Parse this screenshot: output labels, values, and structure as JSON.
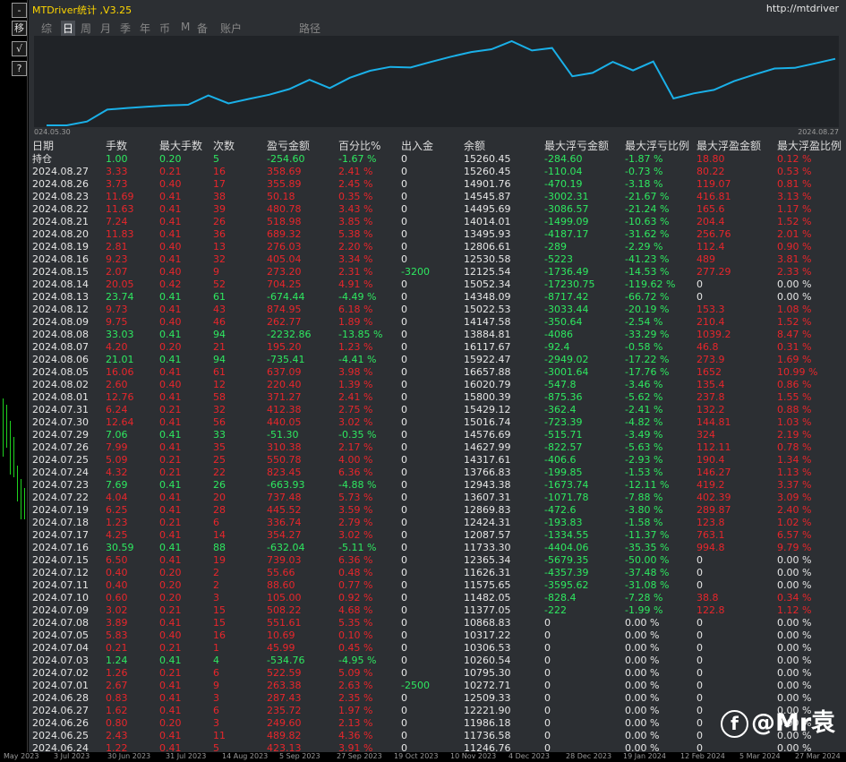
{
  "window": {
    "title": "MTDriver统计 ,V3.25",
    "site": "http://mtdriver"
  },
  "tabs": [
    "综",
    "日",
    "周",
    "月",
    "季",
    "年",
    "币",
    "M",
    "备",
    "账户",
    "",
    "路径"
  ],
  "active_tab": 1,
  "side_buttons": [
    "-",
    "移",
    "√",
    "?"
  ],
  "chart": {
    "type": "line",
    "start_label": "024.05.30",
    "end_label": "2024.08.27",
    "line_color": "#1ab0e8",
    "values": [
      10000,
      10000,
      10306.53,
      11246.76,
      11377.05,
      11482.05,
      11575.65,
      11626.31,
      12365.34,
      11733.3,
      12087.57,
      12424.31,
      12869.83,
      13607.31,
      12943.38,
      13766.83,
      14317.61,
      14627.99,
      14576.69,
      15016.74,
      15429.12,
      15800.39,
      16020.79,
      16657.88,
      15922.47,
      16117.67,
      13884.81,
      14147.58,
      15022.53,
      14348.09,
      15052.34,
      12125.54,
      12530.58,
      12806.61,
      13495.93,
      14014.01,
      14495.69,
      14545.87,
      14901.76,
      15260.45
    ]
  },
  "columns": [
    "日期",
    "手数",
    "最大手数",
    "次数",
    "盈亏金额",
    "百分比%",
    "出入金",
    "余额",
    "最大浮亏金额",
    "最大浮亏比例",
    "最大浮盈金额",
    "最大浮盈比例"
  ],
  "holding": [
    "持仓",
    "1.00",
    "0.20",
    "5",
    "-254.60",
    "-1.67 %",
    "0",
    "15260.45",
    "-284.60",
    "-1.87 %",
    "18.80",
    "0.12 %"
  ],
  "rows": [
    [
      "2024.08.27",
      "3.33",
      "0.21",
      "16",
      "358.69",
      "2.41 %",
      "0",
      "15260.45",
      "-110.04",
      "-0.73 %",
      "80.22",
      "0.53 %"
    ],
    [
      "2024.08.26",
      "3.73",
      "0.40",
      "17",
      "355.89",
      "2.45 %",
      "0",
      "14901.76",
      "-470.19",
      "-3.18 %",
      "119.07",
      "0.81 %"
    ],
    [
      "2024.08.23",
      "11.69",
      "0.41",
      "38",
      "50.18",
      "0.35 %",
      "0",
      "14545.87",
      "-3002.31",
      "-21.67 %",
      "416.81",
      "3.13 %"
    ],
    [
      "2024.08.22",
      "11.63",
      "0.41",
      "39",
      "480.78",
      "3.43 %",
      "0",
      "14495.69",
      "-3086.57",
      "-21.24 %",
      "165.6",
      "1.17 %"
    ],
    [
      "2024.08.21",
      "7.24",
      "0.41",
      "26",
      "518.98",
      "3.85 %",
      "0",
      "14014.01",
      "-1499.09",
      "-10.63 %",
      "204.4",
      "1.52 %"
    ],
    [
      "2024.08.20",
      "11.83",
      "0.41",
      "36",
      "689.32",
      "5.38 %",
      "0",
      "13495.93",
      "-4187.17",
      "-31.62 %",
      "256.76",
      "2.01 %"
    ],
    [
      "2024.08.19",
      "2.81",
      "0.40",
      "13",
      "276.03",
      "2.20 %",
      "0",
      "12806.61",
      "-289",
      "-2.29 %",
      "112.4",
      "0.90 %"
    ],
    [
      "2024.08.16",
      "9.23",
      "0.41",
      "32",
      "405.04",
      "3.34 %",
      "0",
      "12530.58",
      "-5223",
      "-41.23 %",
      "489",
      "3.81 %"
    ],
    [
      "2024.08.15",
      "2.07",
      "0.40",
      "9",
      "273.20",
      "2.31 %",
      "-3200",
      "12125.54",
      "-1736.49",
      "-14.53 %",
      "277.29",
      "2.33 %"
    ],
    [
      "2024.08.14",
      "20.05",
      "0.42",
      "52",
      "704.25",
      "4.91 %",
      "0",
      "15052.34",
      "-17230.75",
      "-119.62 %",
      "0",
      "0.00 %"
    ],
    [
      "2024.08.13",
      "23.74",
      "0.41",
      "61",
      "-674.44",
      "-4.49 %",
      "0",
      "14348.09",
      "-8717.42",
      "-66.72 %",
      "0",
      "0.00 %"
    ],
    [
      "2024.08.12",
      "9.73",
      "0.41",
      "43",
      "874.95",
      "6.18 %",
      "0",
      "15022.53",
      "-3033.44",
      "-20.19 %",
      "153.3",
      "1.08 %"
    ],
    [
      "2024.08.09",
      "9.75",
      "0.40",
      "46",
      "262.77",
      "1.89 %",
      "0",
      "14147.58",
      "-350.64",
      "-2.54 %",
      "210.4",
      "1.52 %"
    ],
    [
      "2024.08.08",
      "33.03",
      "0.41",
      "94",
      "-2232.86",
      "-13.85 %",
      "0",
      "13884.81",
      "-4086",
      "-33.29 %",
      "1039.2",
      "8.47 %"
    ],
    [
      "2024.08.07",
      "4.20",
      "0.20",
      "21",
      "195.20",
      "1.23 %",
      "0",
      "16117.67",
      "-92.4",
      "-0.58 %",
      "46.8",
      "0.31 %"
    ],
    [
      "2024.08.06",
      "21.01",
      "0.41",
      "94",
      "-735.41",
      "-4.41 %",
      "0",
      "15922.47",
      "-2949.02",
      "-17.22 %",
      "273.9",
      "1.69 %"
    ],
    [
      "2024.08.05",
      "16.06",
      "0.41",
      "61",
      "637.09",
      "3.98 %",
      "0",
      "16657.88",
      "-3001.64",
      "-17.76 %",
      "1652",
      "10.99 %"
    ],
    [
      "2024.08.02",
      "2.60",
      "0.40",
      "12",
      "220.40",
      "1.39 %",
      "0",
      "16020.79",
      "-547.8",
      "-3.46 %",
      "135.4",
      "0.86 %"
    ],
    [
      "2024.08.01",
      "12.76",
      "0.41",
      "58",
      "371.27",
      "2.41 %",
      "0",
      "15800.39",
      "-875.36",
      "-5.62 %",
      "237.8",
      "1.55 %"
    ],
    [
      "2024.07.31",
      "6.24",
      "0.21",
      "32",
      "412.38",
      "2.75 %",
      "0",
      "15429.12",
      "-362.4",
      "-2.41 %",
      "132.2",
      "0.88 %"
    ],
    [
      "2024.07.30",
      "12.64",
      "0.41",
      "56",
      "440.05",
      "3.02 %",
      "0",
      "15016.74",
      "-723.39",
      "-4.82 %",
      "144.81",
      "1.03 %"
    ],
    [
      "2024.07.29",
      "7.06",
      "0.41",
      "33",
      "-51.30",
      "-0.35 %",
      "0",
      "14576.69",
      "-515.71",
      "-3.49 %",
      "324",
      "2.19 %"
    ],
    [
      "2024.07.26",
      "7.99",
      "0.41",
      "35",
      "310.38",
      "2.17 %",
      "0",
      "14627.99",
      "-822.57",
      "-5.63 %",
      "112.11",
      "0.78 %"
    ],
    [
      "2024.07.25",
      "5.09",
      "0.21",
      "25",
      "550.78",
      "4.00 %",
      "0",
      "14317.61",
      "-406.6",
      "-2.93 %",
      "190.4",
      "1.34 %"
    ],
    [
      "2024.07.24",
      "4.32",
      "0.21",
      "22",
      "823.45",
      "6.36 %",
      "0",
      "13766.83",
      "-199.85",
      "-1.53 %",
      "146.27",
      "1.13 %"
    ],
    [
      "2024.07.23",
      "7.69",
      "0.41",
      "26",
      "-663.93",
      "-4.88 %",
      "0",
      "12943.38",
      "-1673.74",
      "-12.11 %",
      "419.2",
      "3.37 %"
    ],
    [
      "2024.07.22",
      "4.04",
      "0.41",
      "20",
      "737.48",
      "5.73 %",
      "0",
      "13607.31",
      "-1071.78",
      "-7.88 %",
      "402.39",
      "3.09 %"
    ],
    [
      "2024.07.19",
      "6.25",
      "0.41",
      "28",
      "445.52",
      "3.59 %",
      "0",
      "12869.83",
      "-472.6",
      "-3.80 %",
      "289.87",
      "2.40 %"
    ],
    [
      "2024.07.18",
      "1.23",
      "0.21",
      "6",
      "336.74",
      "2.79 %",
      "0",
      "12424.31",
      "-193.83",
      "-1.58 %",
      "123.8",
      "1.02 %"
    ],
    [
      "2024.07.17",
      "4.25",
      "0.41",
      "14",
      "354.27",
      "3.02 %",
      "0",
      "12087.57",
      "-1334.55",
      "-11.37 %",
      "763.1",
      "6.57 %"
    ],
    [
      "2024.07.16",
      "30.59",
      "0.41",
      "88",
      "-632.04",
      "-5.11 %",
      "0",
      "11733.30",
      "-4404.06",
      "-35.35 %",
      "994.8",
      "9.79 %"
    ],
    [
      "2024.07.15",
      "6.50",
      "0.41",
      "19",
      "739.03",
      "6.36 %",
      "0",
      "12365.34",
      "-5679.35",
      "-50.00 %",
      "0",
      "0.00 %"
    ],
    [
      "2024.07.12",
      "0.40",
      "0.20",
      "2",
      "55.66",
      "0.48 %",
      "0",
      "11626.31",
      "-4357.39",
      "-37.48 %",
      "0",
      "0.00 %"
    ],
    [
      "2024.07.11",
      "0.40",
      "0.20",
      "2",
      "88.60",
      "0.77 %",
      "0",
      "11575.65",
      "-3595.62",
      "-31.08 %",
      "0",
      "0.00 %"
    ],
    [
      "2024.07.10",
      "0.60",
      "0.20",
      "3",
      "105.00",
      "0.92 %",
      "0",
      "11482.05",
      "-828.4",
      "-7.28 %",
      "38.8",
      "0.34 %"
    ],
    [
      "2024.07.09",
      "3.02",
      "0.21",
      "15",
      "508.22",
      "4.68 %",
      "0",
      "11377.05",
      "-222",
      "-1.99 %",
      "122.8",
      "1.12 %"
    ],
    [
      "2024.07.08",
      "3.89",
      "0.41",
      "15",
      "551.61",
      "5.35 %",
      "0",
      "10868.83",
      "0",
      "0.00 %",
      "0",
      "0.00 %"
    ],
    [
      "2024.07.05",
      "5.83",
      "0.40",
      "16",
      "10.69",
      "0.10 %",
      "0",
      "10317.22",
      "0",
      "0.00 %",
      "0",
      "0.00 %"
    ],
    [
      "2024.07.04",
      "0.21",
      "0.21",
      "1",
      "45.99",
      "0.45 %",
      "0",
      "10306.53",
      "0",
      "0.00 %",
      "0",
      "0.00 %"
    ],
    [
      "2024.07.03",
      "1.24",
      "0.41",
      "4",
      "-534.76",
      "-4.95 %",
      "0",
      "10260.54",
      "0",
      "0.00 %",
      "0",
      "0.00 %"
    ],
    [
      "2024.07.02",
      "1.26",
      "0.21",
      "6",
      "522.59",
      "5.09 %",
      "0",
      "10795.30",
      "0",
      "0.00 %",
      "0",
      "0.00 %"
    ],
    [
      "2024.07.01",
      "2.67",
      "0.41",
      "9",
      "263.38",
      "2.63 %",
      "-2500",
      "10272.71",
      "0",
      "0.00 %",
      "0",
      "0.00 %"
    ],
    [
      "2024.06.28",
      "0.83",
      "0.41",
      "3",
      "287.43",
      "2.35 %",
      "0",
      "12509.33",
      "0",
      "0.00 %",
      "0",
      "0.00 %"
    ],
    [
      "2024.06.27",
      "1.62",
      "0.41",
      "6",
      "235.72",
      "1.97 %",
      "0",
      "12221.90",
      "0",
      "0.00 %",
      "0",
      "0.00 %"
    ],
    [
      "2024.06.26",
      "0.80",
      "0.20",
      "3",
      "249.60",
      "2.13 %",
      "0",
      "11986.18",
      "0",
      "0.00 %",
      "0",
      "0.00 %"
    ],
    [
      "2024.06.25",
      "2.43",
      "0.41",
      "11",
      "489.82",
      "4.36 %",
      "0",
      "11736.58",
      "0",
      "0.00 %",
      "0",
      "0.00 %"
    ],
    [
      "2024.06.24",
      "1.22",
      "0.41",
      "5",
      "423.13",
      "3.91 %",
      "0",
      "11246.76",
      "0",
      "0.00 %",
      "0",
      "0.00 %"
    ]
  ],
  "bottom_axis": [
    "May 2023",
    "3 Jul 2023",
    "30 Jun 2023",
    "31 Jul 2023",
    "14 Aug 2023",
    "5 Sep 2023",
    "27 Sep 2023",
    "19 Oct 2023",
    "10 Nov 2023",
    "4 Dec 2023",
    "28 Dec 2023",
    "19 Jan 2024",
    "12 Feb 2024",
    "5 Mar 2024",
    "27 Mar 2024"
  ],
  "watermark": {
    "logo": "f",
    "text": "@Mr袁"
  }
}
